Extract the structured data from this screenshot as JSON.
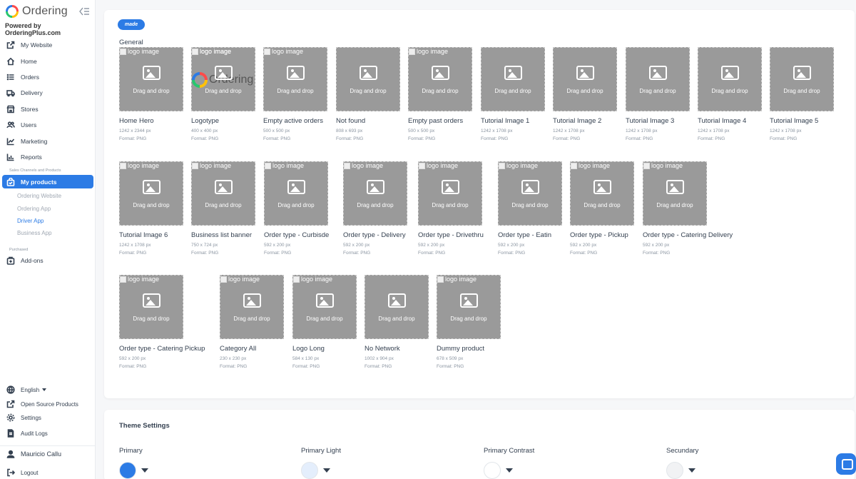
{
  "brand": {
    "name": "Ordering",
    "powered_by": "Powered by OrderingPlus.com"
  },
  "nav": {
    "items": [
      {
        "label": "My Website",
        "icon": "external-link-icon"
      },
      {
        "label": "Home",
        "icon": "home-icon"
      },
      {
        "label": "Orders",
        "icon": "list-icon"
      },
      {
        "label": "Delivery",
        "icon": "truck-icon"
      },
      {
        "label": "Stores",
        "icon": "store-icon"
      },
      {
        "label": "Users",
        "icon": "users-icon"
      },
      {
        "label": "Marketing",
        "icon": "chart-line-icon"
      },
      {
        "label": "Reports",
        "icon": "bar-chart-icon"
      }
    ],
    "section_sales": "Sales Channels and Products",
    "active": "My products",
    "subitems": [
      {
        "label": "Ordering Website",
        "active": false
      },
      {
        "label": "Ordering App",
        "active": false
      },
      {
        "label": "Driver App",
        "active": true
      },
      {
        "label": "Business App",
        "active": false
      }
    ],
    "section_purchased": "Purchased",
    "addons": "Add-ons"
  },
  "bottom": {
    "language": "English",
    "open_source": "Open Source Products",
    "settings": "Settings",
    "audit_logs": "Audit Logs",
    "user": "Mauricio Callu",
    "logout": "Logout"
  },
  "main": {
    "pill": "made",
    "section_title": "General",
    "alt_text": "logo image",
    "drop_text": "Drag and drop",
    "tiles_row1": [
      {
        "name": "Home Hero",
        "dim": "1242 x 2344 px",
        "fmt": "Format: PNG",
        "kind": "blank"
      },
      {
        "name": "Logotype",
        "dim": "400 x 400 px",
        "fmt": "Format: PNG",
        "kind": "logo"
      },
      {
        "name": "Empty active orders",
        "dim": "500 x 500 px",
        "fmt": "Format: PNG",
        "kind": "blank"
      },
      {
        "name": "Not found",
        "dim": "808 x 693 px",
        "fmt": "Format: PNG",
        "kind": "illustration"
      },
      {
        "name": "Empty past orders",
        "dim": "500 x 500 px",
        "fmt": "Format: PNG",
        "kind": "blank"
      },
      {
        "name": "Tutorial Image 1",
        "dim": "1242 x 1708 px",
        "fmt": "Format: PNG",
        "kind": "photo"
      },
      {
        "name": "Tutorial Image 2",
        "dim": "1242 x 1708 px",
        "fmt": "Format: PNG",
        "kind": "photo"
      },
      {
        "name": "Tutorial Image 3",
        "dim": "1242 x 1708 px",
        "fmt": "Format: PNG",
        "kind": "photo"
      },
      {
        "name": "Tutorial Image 4",
        "dim": "1242 x 1708 px",
        "fmt": "Format: PNG",
        "kind": "photo"
      },
      {
        "name": "Tutorial Image 5",
        "dim": "1242 x 1708 px",
        "fmt": "Format: PNG",
        "kind": "photo"
      }
    ],
    "tiles_row2": [
      {
        "name": "Tutorial Image 6",
        "dim": "1242 x 1708 px",
        "fmt": "Format: PNG",
        "kind": "blank"
      },
      {
        "name": "Business list banner",
        "dim": "750 x 724 px",
        "fmt": "Format: PNG",
        "kind": "blank"
      },
      {
        "name": "Order type - Curbisde",
        "dim": "592 x 200 px",
        "fmt": "Format: PNG",
        "kind": "blank"
      },
      {
        "name": "Order type - Delivery",
        "dim": "592 x 200 px",
        "fmt": "Format: PNG",
        "kind": "blank"
      },
      {
        "name": "Order type - Drivethru",
        "dim": "592 x 200 px",
        "fmt": "Format: PNG",
        "kind": "blank"
      },
      {
        "name": "Order type - Eatin",
        "dim": "592 x 200 px",
        "fmt": "Format: PNG",
        "kind": "blank"
      },
      {
        "name": "Order type - Pickup",
        "dim": "592 x 200 px",
        "fmt": "Format: PNG",
        "kind": "blank"
      },
      {
        "name": "Order type - Catering Delivery",
        "dim": "592 x 200 px",
        "fmt": "Format: PNG",
        "kind": "blank"
      }
    ],
    "tiles_row3": [
      {
        "name": "Order type - Catering Pickup",
        "dim": "592 x 200 px",
        "fmt": "Format: PNG",
        "kind": "blank"
      },
      {
        "name": "Category All",
        "dim": "230 x 230 px",
        "fmt": "Format: PNG",
        "kind": "blank"
      },
      {
        "name": "Logo Long",
        "dim": "584 x 130 px",
        "fmt": "Format: PNG",
        "kind": "blank"
      },
      {
        "name": "No Network",
        "dim": "1002 x 904 px",
        "fmt": "Format: PNG",
        "kind": "network"
      },
      {
        "name": "Dummy product",
        "dim": "678 x 509 px",
        "fmt": "Format: PNG",
        "kind": "blank"
      }
    ]
  },
  "theme": {
    "title": "Theme Settings",
    "colors": [
      {
        "label": "Primary",
        "value": "#2c7be5"
      },
      {
        "label": "Primary Light",
        "value": "#e4eefc"
      },
      {
        "label": "Primary Contrast",
        "value": "#ffffff"
      },
      {
        "label": "Secundary",
        "value": "#f1f2f4"
      }
    ]
  }
}
